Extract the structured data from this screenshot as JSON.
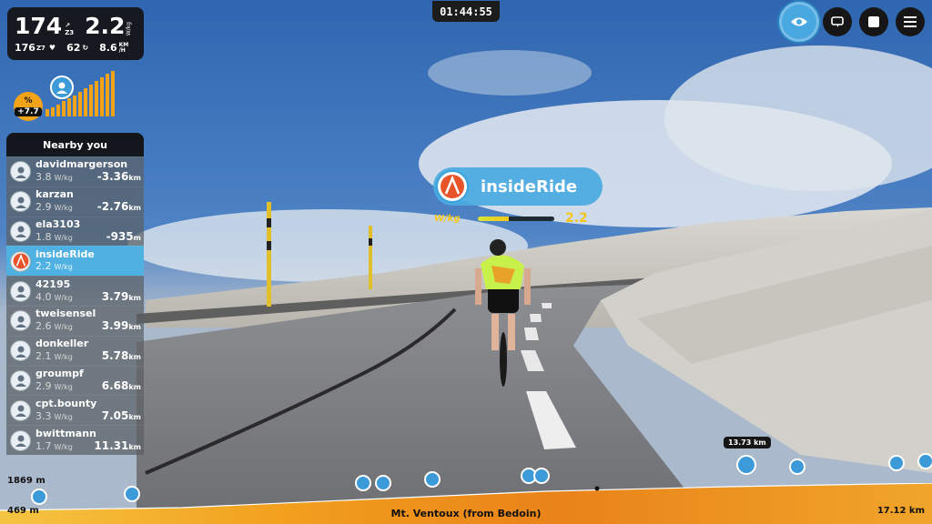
{
  "timer": "01:44:55",
  "stats": {
    "power": "174",
    "zone_top": "↗",
    "zone": "Z3",
    "wkg": "2.2",
    "wkg_unit": "W/kg",
    "heart_rate": "176",
    "cadence_zone": "Z7",
    "cadence": "62",
    "speed": "8.6",
    "speed_unit_top": "KM",
    "speed_unit_bot": "/H"
  },
  "gradient": {
    "label": "%",
    "value": "+7.7"
  },
  "nearby": {
    "title": "Nearby you",
    "riders": [
      {
        "name": "davidmargerson",
        "wkg": "3.8",
        "unit": "W/kg",
        "gap": "-3.36",
        "gap_unit": "km",
        "me": false
      },
      {
        "name": "karzan",
        "wkg": "2.9",
        "unit": "W/kg",
        "gap": "-2.76",
        "gap_unit": "km",
        "me": false
      },
      {
        "name": "ela3103",
        "wkg": "1.8",
        "unit": "W/kg",
        "gap": "-935",
        "gap_unit": "m",
        "me": false
      },
      {
        "name": "insideRide",
        "wkg": "2.2",
        "unit": "W/kg",
        "gap": "",
        "gap_unit": "",
        "me": true
      },
      {
        "name": "42195",
        "wkg": "4.0",
        "unit": "W/kg",
        "gap": "3.79",
        "gap_unit": "km",
        "me": false
      },
      {
        "name": "tweisensel",
        "wkg": "2.6",
        "unit": "W/kg",
        "gap": "3.99",
        "gap_unit": "km",
        "me": false
      },
      {
        "name": "donkeller",
        "wkg": "2.1",
        "unit": "W/kg",
        "gap": "5.78",
        "gap_unit": "km",
        "me": false
      },
      {
        "name": "groumpf",
        "wkg": "2.9",
        "unit": "W/kg",
        "gap": "6.68",
        "gap_unit": "km",
        "me": false
      },
      {
        "name": "cpt.bounty",
        "wkg": "3.3",
        "unit": "W/kg",
        "gap": "7.05",
        "gap_unit": "km",
        "me": false
      },
      {
        "name": "bwittmann",
        "wkg": "1.7",
        "unit": "W/kg",
        "gap": "11.31",
        "gap_unit": "km",
        "me": false
      }
    ]
  },
  "rider_tag": {
    "name": "insideRide",
    "wkg_label": "W/kg",
    "wkg_value": "2.2",
    "wkg_fill_fraction": 0.4
  },
  "controls": {
    "icons": [
      "eye-icon",
      "loop-icon",
      "stop-icon",
      "menu-icon"
    ]
  },
  "profile": {
    "route_name": "Mt. Ventoux (from Bedoin)",
    "elev_max": "1869 m",
    "elev_min": "469 m",
    "distance_total": "17.12 km",
    "current_distance": "13.73 km"
  },
  "colors": {
    "accent": "#4fb1e2",
    "gradient_badge": "#f2a318",
    "wkg_yellow": "#f5c518"
  }
}
